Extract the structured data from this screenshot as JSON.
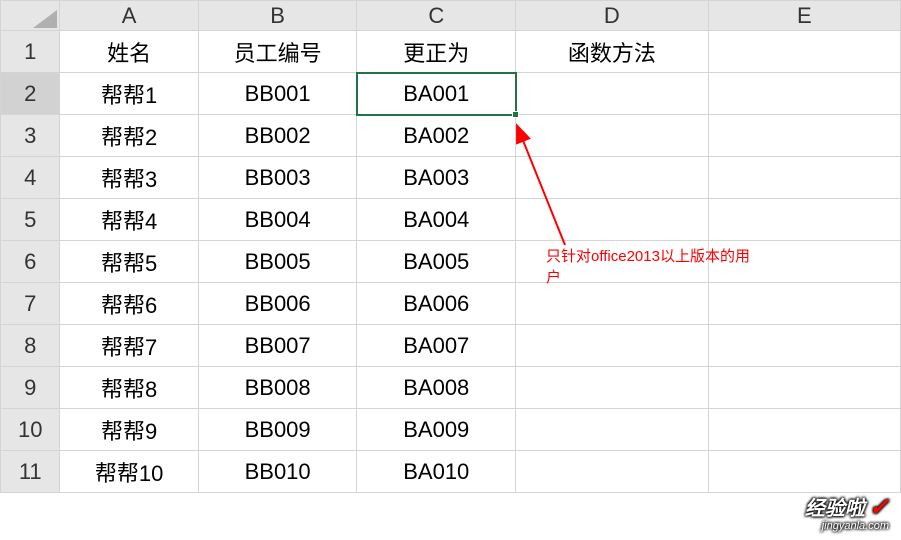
{
  "columns": [
    "A",
    "B",
    "C",
    "D",
    "E"
  ],
  "rowNumbers": [
    "1",
    "2",
    "3",
    "4",
    "5",
    "6",
    "7",
    "8",
    "9",
    "10",
    "11"
  ],
  "headers": {
    "A": "姓名",
    "B": "员工编号",
    "C": "更正为",
    "D": "函数方法",
    "E": ""
  },
  "rows": [
    {
      "A": "帮帮1",
      "B": "BB001",
      "C": "BA001",
      "D": "",
      "E": ""
    },
    {
      "A": "帮帮2",
      "B": "BB002",
      "C": "BA002",
      "D": "",
      "E": ""
    },
    {
      "A": "帮帮3",
      "B": "BB003",
      "C": "BA003",
      "D": "",
      "E": ""
    },
    {
      "A": "帮帮4",
      "B": "BB004",
      "C": "BA004",
      "D": "",
      "E": ""
    },
    {
      "A": "帮帮5",
      "B": "BB005",
      "C": "BA005",
      "D": "",
      "E": ""
    },
    {
      "A": "帮帮6",
      "B": "BB006",
      "C": "BA006",
      "D": "",
      "E": ""
    },
    {
      "A": "帮帮7",
      "B": "BB007",
      "C": "BA007",
      "D": "",
      "E": ""
    },
    {
      "A": "帮帮8",
      "B": "BB008",
      "C": "BA008",
      "D": "",
      "E": ""
    },
    {
      "A": "帮帮9",
      "B": "BB009",
      "C": "BA009",
      "D": "",
      "E": ""
    },
    {
      "A": "帮帮10",
      "B": "BB010",
      "C": "BA010",
      "D": "",
      "E": ""
    }
  ],
  "selectedCell": {
    "row": 2,
    "col": "C"
  },
  "annotation": {
    "line1": "只针对office2013以上版本的用",
    "line2": "户"
  },
  "watermark": {
    "title": "经验啦",
    "url": "jingyanla.com"
  }
}
